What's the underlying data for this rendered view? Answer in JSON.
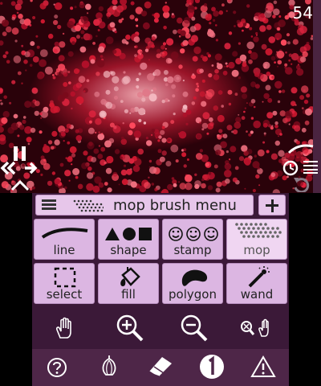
{
  "top": {
    "counter": "54",
    "colors": {
      "base": "#9a1428",
      "highlight": "#e9a0a8",
      "dot": "#d8203c"
    }
  },
  "icons": {
    "top": [
      "pause-icon",
      "rewind-icon",
      "forward-icon",
      "chevron-up-icon",
      "wave-icon",
      "clock-icon",
      "list-icon",
      "undo-icon"
    ],
    "bottom": [
      "hand-icon",
      "zoom-in-icon",
      "zoom-out-icon",
      "zoom-reset-icon",
      "help-icon",
      "onion-icon",
      "eraser-icon",
      "layer-one-icon",
      "warning-icon"
    ]
  },
  "menu": {
    "title": "mop brush menu",
    "add_label": "+"
  },
  "tools": [
    {
      "label": "line",
      "icon": "line-icon"
    },
    {
      "label": "shape",
      "icon": "shape-icon"
    },
    {
      "label": "stamp",
      "icon": "stamp-icon"
    },
    {
      "label": "mop",
      "icon": "mop-icon",
      "active": true
    },
    {
      "label": "select",
      "icon": "select-icon"
    },
    {
      "label": "fill",
      "icon": "fill-icon"
    },
    {
      "label": "polygon",
      "icon": "polygon-icon"
    },
    {
      "label": "wand",
      "icon": "wand-icon"
    }
  ],
  "bottom_colors": {
    "panel": "#3b1938",
    "button": "#dcb6e2",
    "active_button": "#f0d6f2"
  }
}
